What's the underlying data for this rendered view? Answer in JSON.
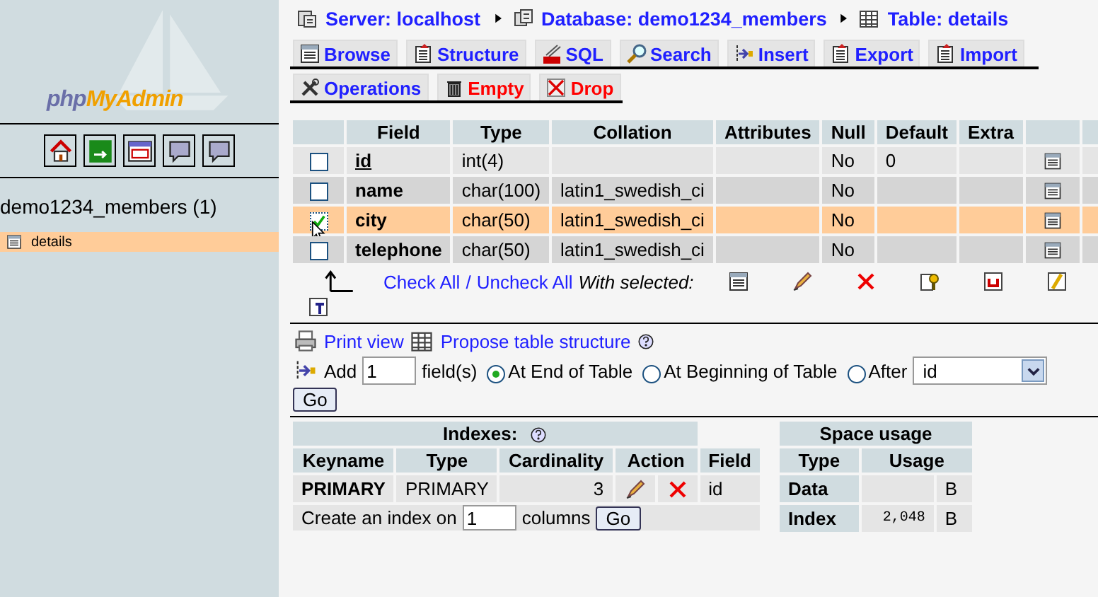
{
  "sidebar": {
    "logo": [
      "php",
      "MyAdmin"
    ],
    "database": "demo1234_members (1)",
    "tables": [
      {
        "name": "details",
        "selected": true
      }
    ]
  },
  "breadcrumb": [
    {
      "kind": "server",
      "label": "Server: localhost"
    },
    {
      "kind": "database",
      "label": "Database: demo1234_members"
    },
    {
      "kind": "table",
      "label": "Table: details"
    }
  ],
  "tabs": [
    {
      "kind": "browse",
      "label": "Browse",
      "danger": false,
      "selected": false
    },
    {
      "kind": "structure",
      "label": "Structure",
      "danger": false,
      "selected": false
    },
    {
      "kind": "sql",
      "label": "SQL",
      "danger": false,
      "selected": false
    },
    {
      "kind": "search",
      "label": "Search",
      "danger": false,
      "selected": false
    },
    {
      "kind": "insert",
      "label": "Insert",
      "danger": false,
      "selected": false
    },
    {
      "kind": "export",
      "label": "Export",
      "danger": false,
      "selected": false
    },
    {
      "kind": "import",
      "label": "Import",
      "danger": false,
      "selected": false
    },
    {
      "kind": "operations",
      "label": "Operations",
      "danger": false,
      "selected": false
    },
    {
      "kind": "empty",
      "label": "Empty",
      "danger": true,
      "selected": false
    },
    {
      "kind": "drop",
      "label": "Drop",
      "danger": true,
      "selected": false
    }
  ],
  "structure": {
    "columns": [
      "Field",
      "Type",
      "Collation",
      "Attributes",
      "Null",
      "Default",
      "Extra"
    ],
    "rows": [
      {
        "field": "id",
        "primary": true,
        "type": "int(4)",
        "null": "No",
        "default": "0",
        "checked": false
      },
      {
        "field": "name",
        "primary": false,
        "type": "char(100)",
        "collation": "latin1_swedish_ci",
        "null": "No",
        "checked": false
      },
      {
        "field": "city",
        "primary": false,
        "type": "char(50)",
        "collation": "latin1_swedish_ci",
        "null": "No",
        "checked": true
      },
      {
        "field": "telephone",
        "primary": false,
        "type": "char(50)",
        "collation": "latin1_swedish_ci",
        "null": "No",
        "checked": false
      }
    ]
  },
  "with_selected": {
    "check_all": "Check All",
    "separator": "/",
    "uncheck_all": "Uncheck All",
    "label": "With selected:"
  },
  "links": [
    {
      "kind": "print",
      "label": "Print view"
    },
    {
      "kind": "propose",
      "label": "Propose table structure"
    }
  ],
  "add_fields": {
    "label": "Add",
    "count": "1",
    "unit": "field(s)",
    "positions": [
      {
        "label": "At End of Table",
        "selected": true
      },
      {
        "label": "At Beginning of Table",
        "selected": false
      },
      {
        "label": "After",
        "selected": false
      }
    ],
    "after_value": "id",
    "button": "Go"
  },
  "indexes": {
    "title": "Indexes:",
    "columns": [
      "Keyname",
      "Type",
      "Cardinality",
      "Action",
      "Field"
    ],
    "rows": [
      {
        "keyname": "PRIMARY",
        "type": "PRIMARY",
        "cardinality": "3",
        "field": "id"
      }
    ],
    "create": {
      "label": "Create an index on",
      "count": "1",
      "unit": "columns",
      "button": "Go"
    }
  },
  "space_usage": {
    "title": "Space usage",
    "columns": [
      "Type",
      "Usage"
    ],
    "rows": [
      {
        "type": "Data",
        "unit": "B"
      },
      {
        "type": "Index",
        "usage": "2,048",
        "unit": "B"
      }
    ]
  }
}
